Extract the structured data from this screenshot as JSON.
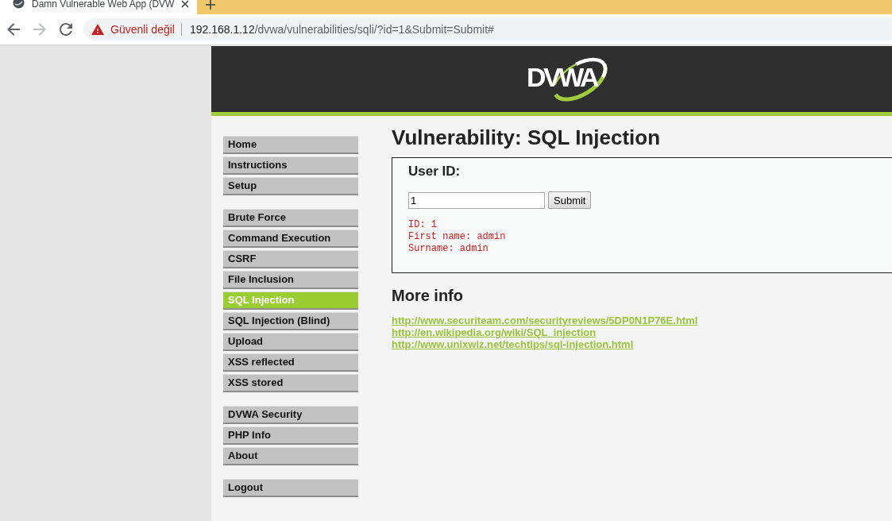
{
  "browser": {
    "tabs": [
      {
        "title": "Damn Vulnerable Web App (DVW",
        "selected": true
      }
    ],
    "nav_buttons": [
      {
        "kind": "back",
        "disabled": false
      },
      {
        "kind": "forward",
        "disabled": true
      },
      {
        "kind": "reload",
        "disabled": false
      }
    ],
    "address_bar": {
      "security_label": "Güvenli değil",
      "url_host": "192.168.1.12",
      "url_path": "/dvwa/vulnerabilities/sqli/?id=1&Submit=Submit#"
    }
  },
  "header": {
    "logo_text": "DVWA"
  },
  "menu": {
    "groups": [
      {
        "items": [
          {
            "label": "Home",
            "selected": false
          },
          {
            "label": "Instructions",
            "selected": false
          },
          {
            "label": "Setup",
            "selected": false
          }
        ]
      },
      {
        "items": [
          {
            "label": "Brute Force",
            "selected": false
          },
          {
            "label": "Command Execution",
            "selected": false
          },
          {
            "label": "CSRF",
            "selected": false
          },
          {
            "label": "File Inclusion",
            "selected": false
          },
          {
            "label": "SQL Injection",
            "selected": true
          },
          {
            "label": "SQL Injection (Blind)",
            "selected": false
          },
          {
            "label": "Upload",
            "selected": false
          },
          {
            "label": "XSS reflected",
            "selected": false
          },
          {
            "label": "XSS stored",
            "selected": false
          }
        ]
      },
      {
        "items": [
          {
            "label": "DVWA Security",
            "selected": false
          },
          {
            "label": "PHP Info",
            "selected": false
          },
          {
            "label": "About",
            "selected": false
          }
        ]
      },
      {
        "items": [
          {
            "label": "Logout",
            "selected": false
          }
        ]
      }
    ]
  },
  "main": {
    "title": "Vulnerability: SQL Injection",
    "form": {
      "label": "User ID:",
      "input": {
        "value": "1"
      },
      "button": "Submit"
    },
    "output": [
      "ID: 1",
      "First name: admin",
      "Surname: admin"
    ],
    "more_info": {
      "title": "More info",
      "links": [
        "http://www.securiteam.com/securityreviews/5DP0N1P76E.html",
        "http://en.wikipedia.org/wiki/SQL_injection",
        "http://www.unixwiz.net/techtips/sql-injection.html"
      ]
    }
  }
}
